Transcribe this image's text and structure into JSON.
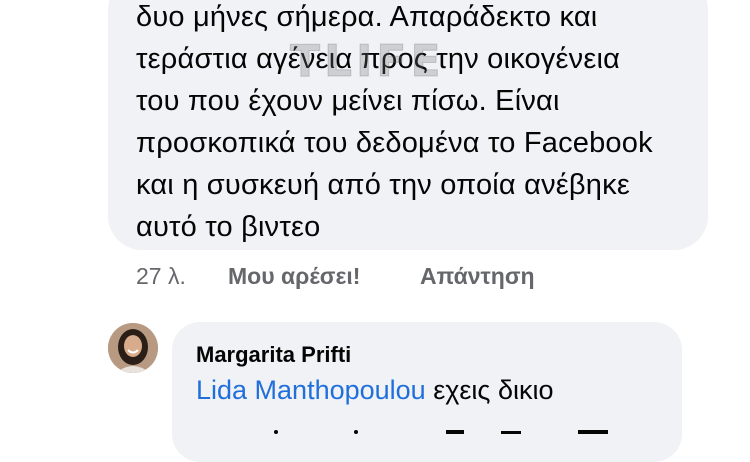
{
  "comment": {
    "lines": [
      "δυο μήνες σήμερα. Απαράδεκτο και",
      "τεράστια αγένεια προς την οικογένεια",
      "του που έχουν μείνει πίσω. Είναι",
      "προσκοπικά του δεδομένα το Facebook",
      "και η συσκευή από την οποία ανέβηκε",
      "αυτό το βιντεο"
    ],
    "watermark": "TLIFE",
    "time": "27 λ.",
    "like_label": "Μου αρέσει!",
    "reply_label": "Απάντηση"
  },
  "reply": {
    "author": "Margarita Prifti",
    "mention": "Lida Manthopoulou",
    "text": " εχεις δικιο"
  },
  "colors": {
    "bubble": "#f0f2f5",
    "mention": "#216fdb",
    "meta": "#65676b"
  }
}
